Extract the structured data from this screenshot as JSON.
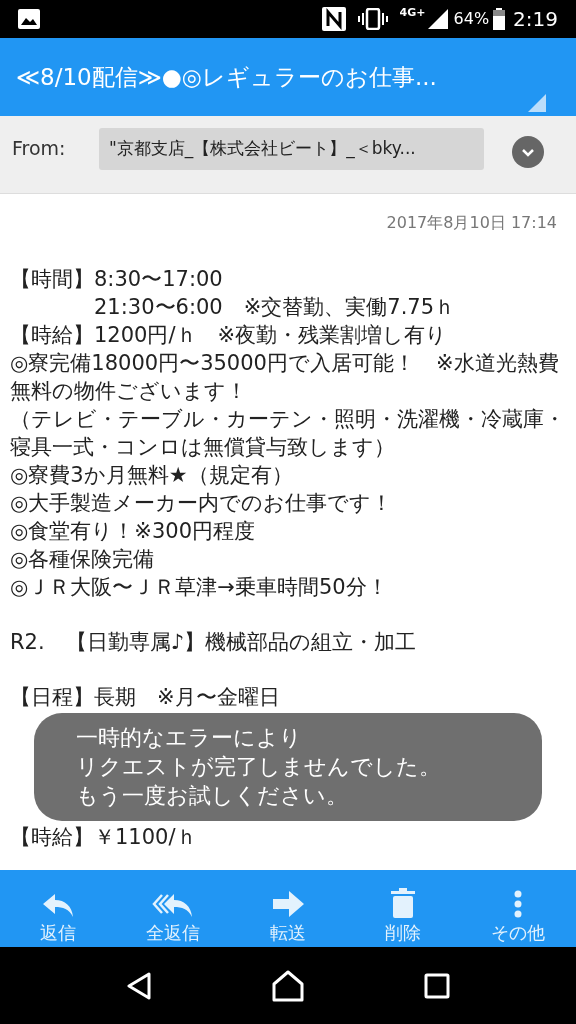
{
  "status_bar": {
    "network": "4G+",
    "battery": "64%",
    "time": "2:19"
  },
  "header": {
    "title": "≪8/10配信≫●◎レギュラーのお仕事..."
  },
  "from": {
    "label": "From:",
    "value": "\"京都支店_【株式会社ビート】_＜bky..."
  },
  "date": "2017年8月10日 17:14",
  "body": [
    {
      "kind": "line",
      "text": "【時間】8:30〜17:00"
    },
    {
      "kind": "indented",
      "text": "21:30〜6:00　※交替勤、実働7.75ｈ"
    },
    {
      "kind": "line",
      "text": "【時給】1200円/ｈ　※夜勤・残業割増し有り"
    },
    {
      "kind": "line",
      "text": "◎寮完備18000円〜35000円で入居可能！　※水道光熱費無料の物件ございます！"
    },
    {
      "kind": "line",
      "text": "（テレビ・テーブル・カーテン・照明・洗濯機・冷蔵庫・寝具一式・コンロは無償貸与致します）"
    },
    {
      "kind": "line",
      "text": "◎寮費3か月無料★（規定有）"
    },
    {
      "kind": "line",
      "text": "◎大手製造メーカー内でのお仕事です！"
    },
    {
      "kind": "line",
      "text": "◎食堂有り！※300円程度"
    },
    {
      "kind": "line",
      "text": "◎各種保険完備"
    },
    {
      "kind": "line",
      "text": "◎ＪＲ大阪〜ＪＲ草津→乗車時間50分！"
    },
    {
      "kind": "heading",
      "text": "R2.　【日勤専属♪】機械部品の組立・加工"
    },
    {
      "kind": "line",
      "text": "【日程】長期　※月〜金曜日"
    },
    {
      "kind": "toast"
    },
    {
      "kind": "line",
      "text": "【時給】￥1100/ｈ"
    }
  ],
  "toast": {
    "lines": [
      "一時的なエラーにより",
      "リクエストが完了しませんでした。",
      "もう一度お試しください。"
    ]
  },
  "actions": [
    {
      "kind": "reply",
      "label": "返信"
    },
    {
      "kind": "reply_all",
      "label": "全返信"
    },
    {
      "kind": "forward",
      "label": "転送"
    },
    {
      "kind": "delete",
      "label": "削除"
    },
    {
      "kind": "more",
      "label": "その他"
    }
  ]
}
